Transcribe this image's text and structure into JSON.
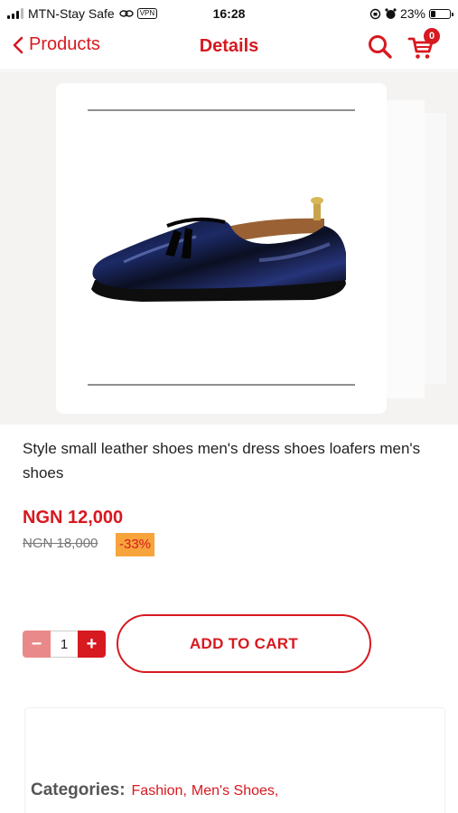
{
  "status_bar": {
    "carrier": "MTN-Stay Safe",
    "vpn": "VPN",
    "time": "16:28",
    "battery": "23%",
    "battery_level": 0.23
  },
  "nav": {
    "back_label": "Products",
    "title": "Details",
    "cart_count": "0"
  },
  "product": {
    "title": "Style small leather shoes men's dress shoes loafers men's shoes",
    "price": "NGN 12,000",
    "old_price": "NGN 18,000",
    "discount": "-33%",
    "quantity": "1"
  },
  "actions": {
    "minus": "−",
    "plus": "+",
    "add_to_cart": "ADD TO CART"
  },
  "categories": {
    "label": "Categories:",
    "items": [
      "Fashion,",
      "Men's Shoes,"
    ]
  },
  "colors": {
    "accent": "#d71920",
    "discount_bg": "#f7a43c"
  }
}
